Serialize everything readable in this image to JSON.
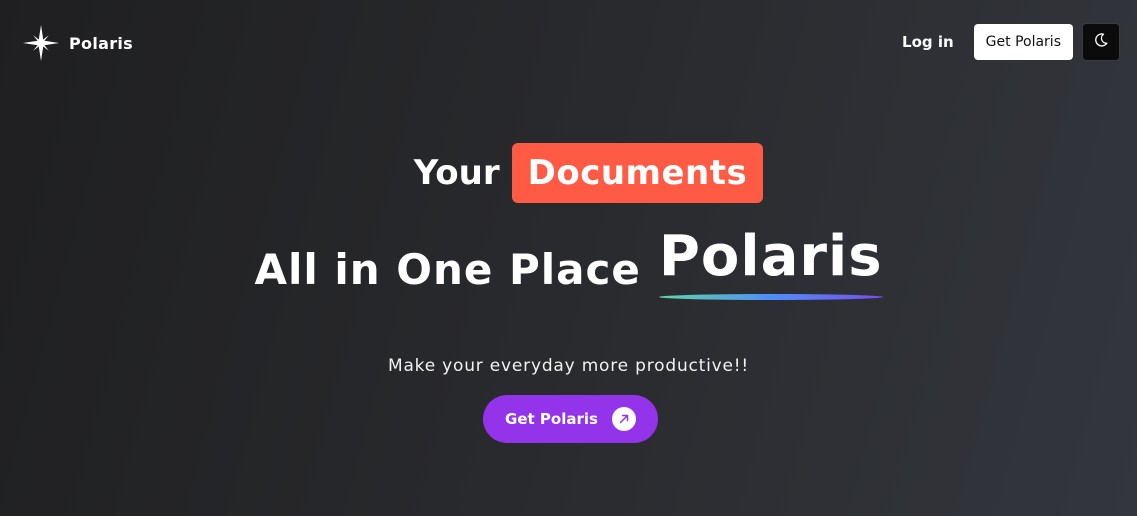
{
  "nav": {
    "brand_name": "Polaris",
    "brand_icon": "sparkle-star-icon",
    "login_label": "Log in",
    "get_label": "Get Polaris",
    "theme_icon": "moon-icon"
  },
  "hero": {
    "line1_prefix": "Your",
    "line1_highlight": "Documents",
    "line2_text": "All in One Place",
    "line2_brand": "Polaris",
    "subtitle": "Make your everyday more productive!!",
    "cta_label": "Get Polaris",
    "cta_icon": "arrow-up-right-icon"
  },
  "colors": {
    "highlight": "#ff5a44",
    "cta": "#9333ea",
    "underline_start": "#5fd6a8",
    "underline_mid": "#4f8ef7",
    "underline_end": "#7b4cf0"
  }
}
